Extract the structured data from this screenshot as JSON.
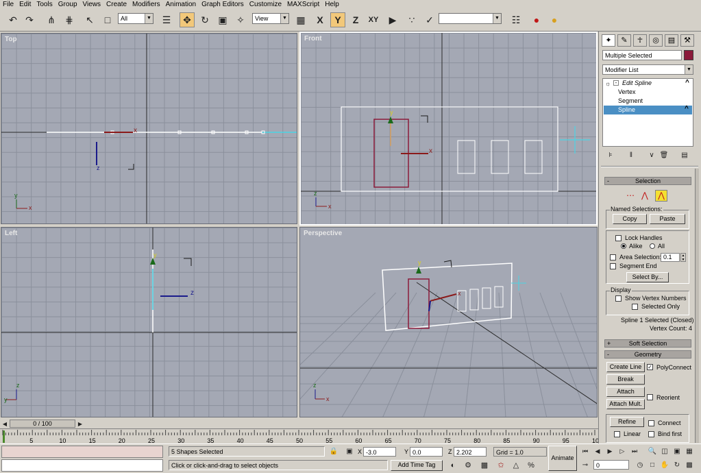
{
  "menu": [
    "File",
    "Edit",
    "Tools",
    "Group",
    "Views",
    "Create",
    "Modifiers",
    "Animation",
    "Graph Editors",
    "Customize",
    "MAXScript",
    "Help"
  ],
  "toolbar": {
    "filter_value": "All",
    "coord_value": "View",
    "named_sel_value": "",
    "axis_x": "X",
    "axis_y": "Y",
    "axis_z": "Z",
    "axis_xy": "XY"
  },
  "viewports": {
    "top": "Top",
    "front": "Front",
    "left": "Left",
    "perspective": "Perspective"
  },
  "axis_letters": {
    "x": "x",
    "y": "y",
    "z": "z"
  },
  "timeline": {
    "slider": "0 / 100",
    "ticks": [
      "5",
      "10",
      "15",
      "20",
      "25",
      "30",
      "35",
      "40",
      "45",
      "50",
      "55",
      "60",
      "65",
      "70",
      "75",
      "80",
      "85",
      "90",
      "95",
      "10"
    ]
  },
  "status": {
    "prompt_text": "5 Shapes Selected",
    "hint_text": "Click or click-and-drag to select objects",
    "x_label": "X",
    "y_label": "Y",
    "z_label": "Z",
    "x_value": "-3.0",
    "y_value": "0.0",
    "z_value": "2.202",
    "grid_text": "Grid = 1.0",
    "add_time_tag": "Add Time Tag",
    "animate": "Animate",
    "frame_value": "0"
  },
  "command_panel": {
    "object_name": "Multiple Selected",
    "object_color": "#8b1a3a",
    "modifier_list": "Modifier List",
    "stack": {
      "edit_spline": "Edit Spline",
      "vertex": "Vertex",
      "segment": "Segment",
      "spline": "Spline"
    },
    "selection": {
      "title": "Selection",
      "named_selections": "Named Selections:",
      "copy": "Copy",
      "paste": "Paste",
      "lock_handles": "Lock Handles",
      "alike": "Alike",
      "all": "All",
      "area_selection": "Area Selection:",
      "area_value": "0.1",
      "segment_end": "Segment End",
      "select_by": "Select By...",
      "display": "Display",
      "show_vertex_numbers": "Show Vertex Numbers",
      "selected_only": "Selected Only",
      "info_line1": "Spline 1 Selected (Closed)",
      "info_line2": "Vertex Count: 4"
    },
    "soft_selection": "Soft Selection",
    "geometry": {
      "title": "Geometry",
      "create_line": "Create Line",
      "polyconnect": "PolyConnect",
      "break": "Break",
      "attach": "Attach",
      "reorient": "Reorient",
      "attach_mult": "Attach Mult.",
      "refine": "Refine",
      "connect": "Connect",
      "linear": "Linear",
      "bind_first": "Bind first"
    }
  },
  "colors": {
    "viewport_bg": "#a4a8b4",
    "selected_spline": "#ffffff",
    "shape_color": "#8b1a3a",
    "highlight": "#4a9fd4"
  }
}
